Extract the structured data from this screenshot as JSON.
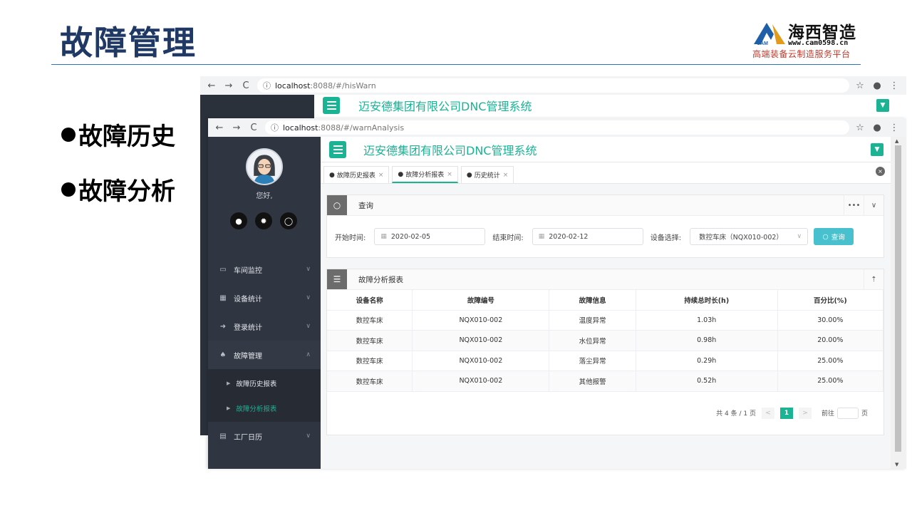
{
  "slide": {
    "title": "故障管理",
    "bullets": [
      "故障历史",
      "故障分析"
    ],
    "logo": {
      "brand": "海西智造",
      "site": "www.cam0598.cn",
      "slogan": "高端装备云制造服务平台",
      "mark_text": "CAM"
    }
  },
  "back_window": {
    "url_host": "localhost",
    "url_rest": ":8088/#/hisWarn",
    "app_title": "迈安德集团有限公司DNC管理系统"
  },
  "front_window": {
    "url_host": "localhost",
    "url_rest": ":8088/#/warnAnalysis",
    "app_title": "迈安德集团有限公司DNC管理系统",
    "greeting": "您好,",
    "sidebar": {
      "items": [
        {
          "label": "车间监控",
          "icon": "monitor-icon"
        },
        {
          "label": "设备统计",
          "icon": "table-icon"
        },
        {
          "label": "登录统计",
          "icon": "login-icon"
        },
        {
          "label": "故障管理",
          "icon": "bell-icon"
        },
        {
          "label": "工厂日历",
          "icon": "calendar-icon"
        }
      ],
      "subitems": [
        {
          "label": "故障历史报表"
        },
        {
          "label": "故障分析报表"
        }
      ]
    },
    "tabs": [
      {
        "label": "故障历史报表"
      },
      {
        "label": "故障分析报表"
      },
      {
        "label": "历史统计"
      }
    ],
    "query": {
      "title": "查询",
      "start_label": "开始时间:",
      "start_value": "2020-02-05",
      "end_label": "结束时间:",
      "end_value": "2020-02-12",
      "device_label": "设备选择:",
      "device_value": "数控车床（NQX010-002）",
      "button": "查询"
    },
    "report": {
      "title": "故障分析报表",
      "columns": [
        "设备名称",
        "故障编号",
        "故障信息",
        "持续总时长(h)",
        "百分比(%)"
      ],
      "rows": [
        [
          "数控车床",
          "NQX010-002",
          "温度异常",
          "1.03h",
          "30.00%"
        ],
        [
          "数控车床",
          "NQX010-002",
          "水位异常",
          "0.98h",
          "20.00%"
        ],
        [
          "数控车床",
          "NQX010-002",
          "落尘异常",
          "0.29h",
          "25.00%"
        ],
        [
          "数控车床",
          "NQX010-002",
          "其他报警",
          "0.52h",
          "25.00%"
        ]
      ]
    },
    "pager": {
      "summary": "共 4 条 / 1 页",
      "current": "1",
      "goto": "前往",
      "page_unit": "页"
    }
  },
  "colors": {
    "accent": "#1ab394",
    "title": "#1f3864",
    "sidebar": "#2f3541"
  }
}
